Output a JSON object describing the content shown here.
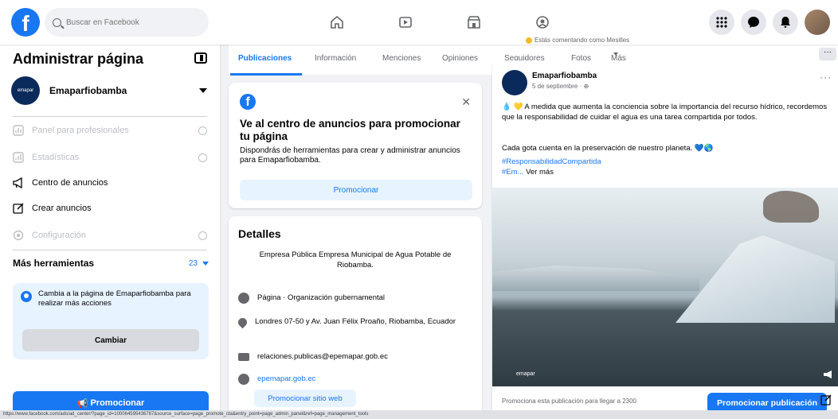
{
  "topbar": {
    "logo": "f",
    "search_placeholder": "Buscar en Facebook",
    "nav_icons": [
      "home-icon",
      "watch-icon",
      "marketplace-icon",
      "groups-icon"
    ],
    "right_icons": [
      "menu-grid-icon",
      "messenger-icon",
      "notifications-icon",
      "account-avatar"
    ]
  },
  "sidebar": {
    "title": "Administrar página",
    "page_name": "Emaparfiobamba",
    "page_avatar_text": "emapar",
    "items": [
      {
        "label": "Panel para profesionales",
        "icon": "dashboard-icon",
        "disabled": true
      },
      {
        "label": "Estadísticas",
        "icon": "insights-icon",
        "disabled": true
      },
      {
        "label": "Centro de anuncios",
        "icon": "megaphone-icon",
        "disabled": false
      },
      {
        "label": "Crear anuncios",
        "icon": "edit-icon",
        "disabled": false
      },
      {
        "label": "Configuración",
        "icon": "settings-icon",
        "disabled": true
      }
    ],
    "more_tools_label": "Más herramientas",
    "more_tools_count": "23",
    "switch_text": "Cambia a la página de Emaparfiobamba para realizar más acciones",
    "switch_button": "Cambiar",
    "promote_button": "Promocionar"
  },
  "tabs": {
    "items": [
      "Publicaciones",
      "Información",
      "Menciones",
      "Opiniones",
      "Seguidores",
      "Fotos",
      "Más"
    ],
    "active": "Publicaciones",
    "comment_hint": "Estás comentando como Mesilles"
  },
  "ads_card": {
    "title": "Ve al centro de anuncios para promocionar tu página",
    "description": "Dispondrás de herramientas para crear y administrar anuncios para Emaparfiobamba.",
    "button": "Promocionar"
  },
  "details": {
    "title": "Detalles",
    "description": "Empresa Pública Empresa Municipal de Agua Potable de Riobamba.",
    "category": "Página · Organización gubernamental",
    "address": "Londres 07-50 y Av. Juan Félix Proaño, Riobamba, Ecuador",
    "email": "relaciones.publicas@epemapar.gob.ec",
    "website": "epemapar.gob.ec",
    "web_button": "Promocionar sitio web"
  },
  "post": {
    "author": "Emaparfiobamba",
    "date": "5 de septiembre · ⊕",
    "text": "💧 💛 A medida que aumenta la conciencia sobre la importancia del recurso hídrico, recordemos que la responsabilidad de cuidar el agua es una tarea compartida por todos.",
    "text2": "Cada gota cuenta en la preservación de nuestro planeta. 💙🌎",
    "hashtag": "#ResponsabilidadCompartida",
    "hashtag2": "#Em...",
    "see_more": "Ver más",
    "image_watermark": "emapar",
    "footer_text": "Promociona esta publicación para llegar a 2300",
    "promote_post_button": "Promocionar publicación"
  },
  "statusbar": {
    "url": "https://www.facebook.com/ads/ad_center/?page_id=100064595436787&source_surface=page_promote_cta&entry_point=page_admin_panel&ref=page_management_tools"
  },
  "colors": {
    "brand": "#1877f2",
    "background": "#f0f2f5",
    "text_secondary": "#65676b"
  }
}
